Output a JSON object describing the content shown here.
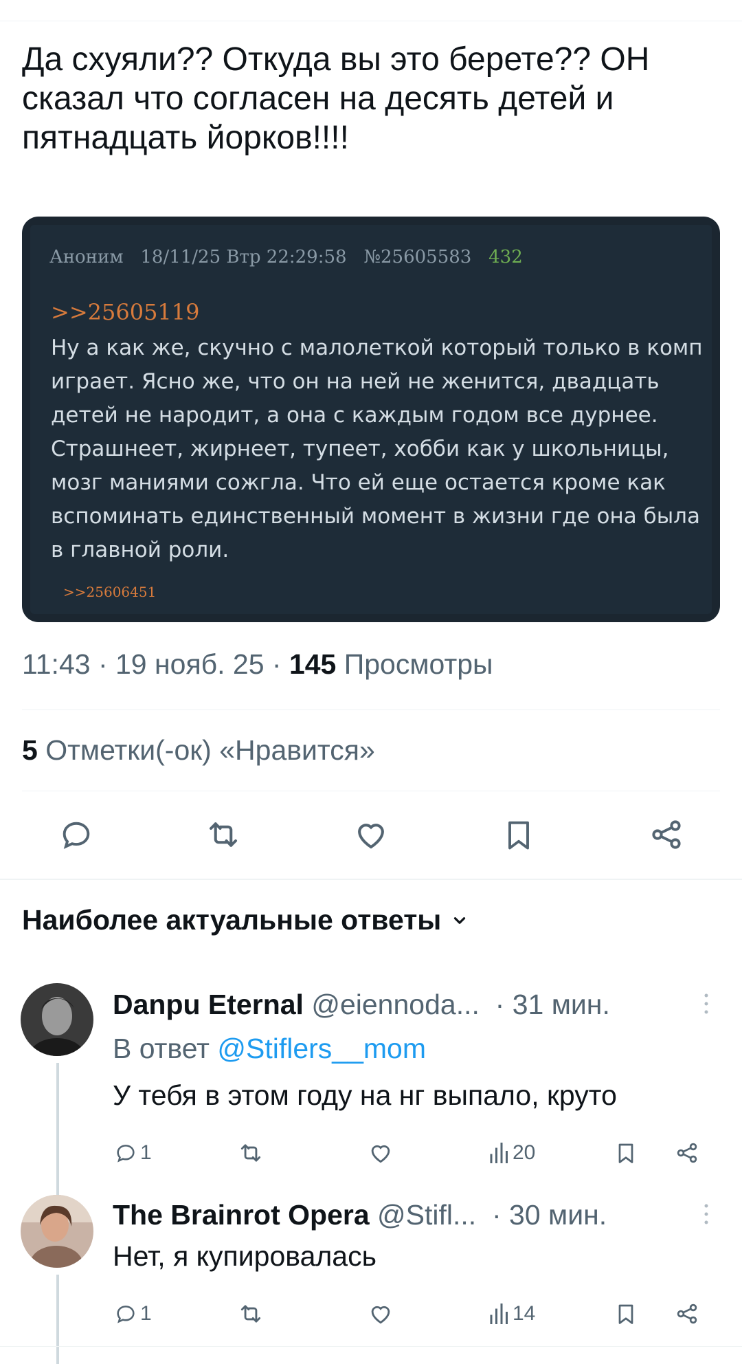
{
  "tweet": {
    "text": "Да схуяли?? Откуда вы это берете?? ОН сказал что согласен на десять детей и пятнадцать йорков!!!!"
  },
  "embed": {
    "author": "Аноним",
    "datetime": "18/11/25 Втр 22:29:58",
    "post_number": "№25605583",
    "post_count": "432",
    "reply_to": ">>25605119",
    "body": "Ну а как же, скучно с малолеткой который только в комп играет. Ясно же, что он на ней не женится, двадцать детей не народит, а она с каждым годом все дурнее. Страшнеет, жирнеет, тупеет, хобби как у школьницы, мозг маниями сожгла. Что ей еще остается кроме как вспоминать единственный момент в жизни где она была в главной роли.",
    "replies": ">>25606451"
  },
  "meta": {
    "time": "11:43",
    "date": "19 нояб. 25",
    "views_count": "145",
    "views_label": "Просмотры",
    "likes_count": "5",
    "likes_label": "Отметки(-ок) «Нравится»"
  },
  "actions": {
    "icons": [
      "reply-icon",
      "retweet-icon",
      "like-icon",
      "bookmark-icon",
      "share-icon"
    ]
  },
  "replies_section": {
    "title": "Наиболее актуальные ответы"
  },
  "replies": [
    {
      "name": "Danpu Eternal",
      "handle": "@eiennoda...",
      "time": "· 31 мин.",
      "reply_to_prefix": "В ответ",
      "reply_to_handle": "@Stiflers__mom",
      "text": "У тебя в этом году на нг выпало, круто",
      "reply_count": "1",
      "views": "20"
    },
    {
      "name": "The Brainrot Opera",
      "handle": "@Stifl...",
      "time": "· 30 мин.",
      "text": "Нет, я купировалась",
      "reply_count": "1",
      "views": "14"
    }
  ],
  "colors": {
    "accent": "#1d9bf0",
    "text_primary": "#0f1419",
    "text_secondary": "#536471",
    "embed_bg": "#1e2c38",
    "embed_link": "#d87b3c",
    "embed_count": "#6fae52"
  }
}
